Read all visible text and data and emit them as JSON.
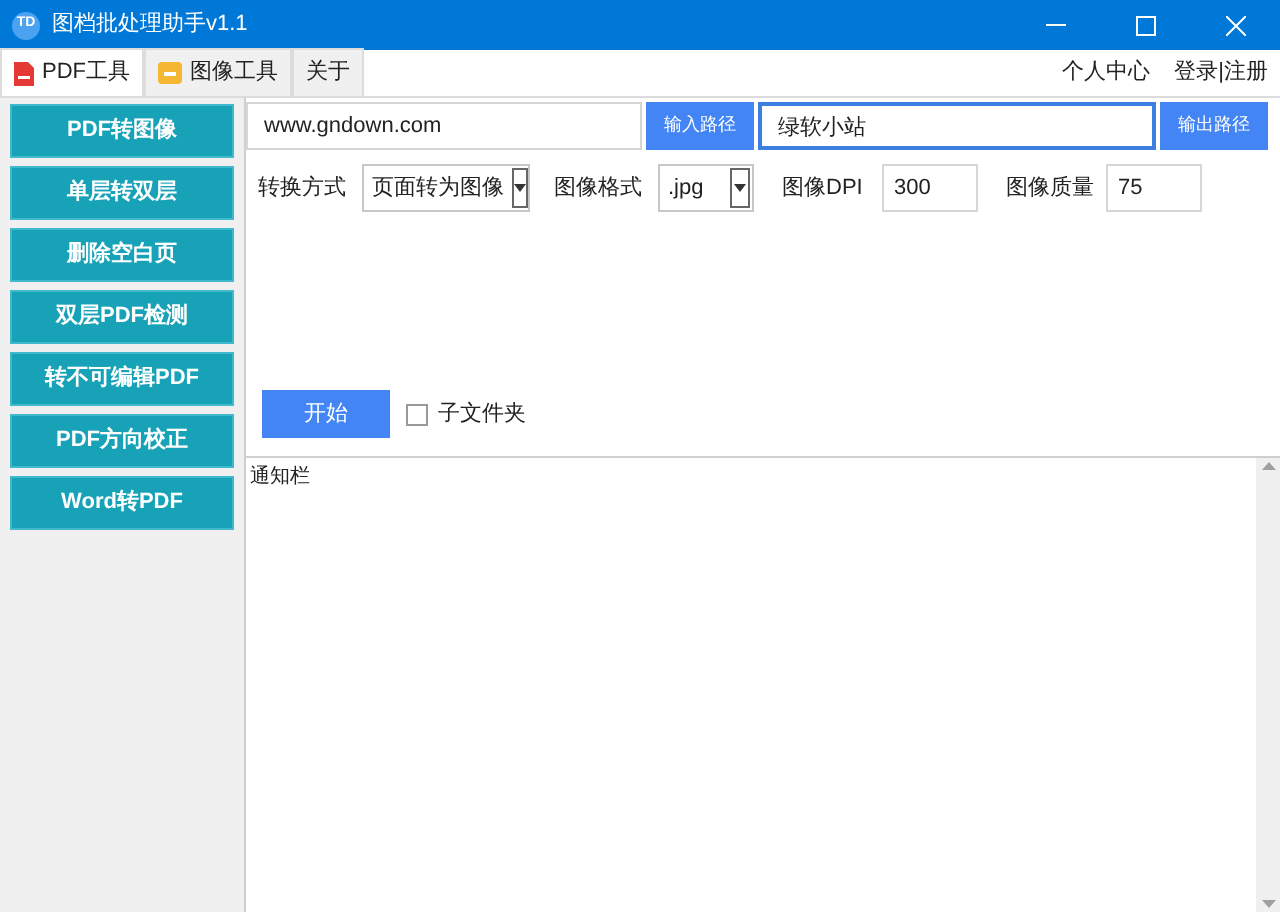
{
  "window": {
    "title": "图档批处理助手v1.1",
    "logo": "TD"
  },
  "tabs": [
    {
      "label": "PDF工具",
      "selected": true,
      "kind": "pdf"
    },
    {
      "label": "图像工具",
      "selected": false,
      "kind": "image"
    },
    {
      "label": "关于",
      "selected": false,
      "kind": "plain"
    }
  ],
  "header_links": [
    "个人中心",
    "登录|注册"
  ],
  "sidebar": {
    "items": [
      "PDF转图像",
      "单层转双层",
      "删除空白页",
      "双层PDF检测",
      "转不可编辑PDF",
      "PDF方向校正",
      "Word转PDF"
    ]
  },
  "input_path": {
    "value": "www.gndown.com",
    "button": "输入路径"
  },
  "output_path": {
    "value": "绿软小站",
    "focused": true,
    "button": "输出路径"
  },
  "options": {
    "mode_label": "转换方式",
    "mode": "页面转为图像",
    "format_label": "图像格式",
    "format": ".jpg",
    "dpi_label": "图像DPI",
    "dpi": "300",
    "quality_label": "图像质量",
    "quality": "75"
  },
  "start_button": "开始",
  "subfolder": {
    "label": "子文件夹",
    "checked": false
  },
  "notice": {
    "text": "通知栏"
  }
}
